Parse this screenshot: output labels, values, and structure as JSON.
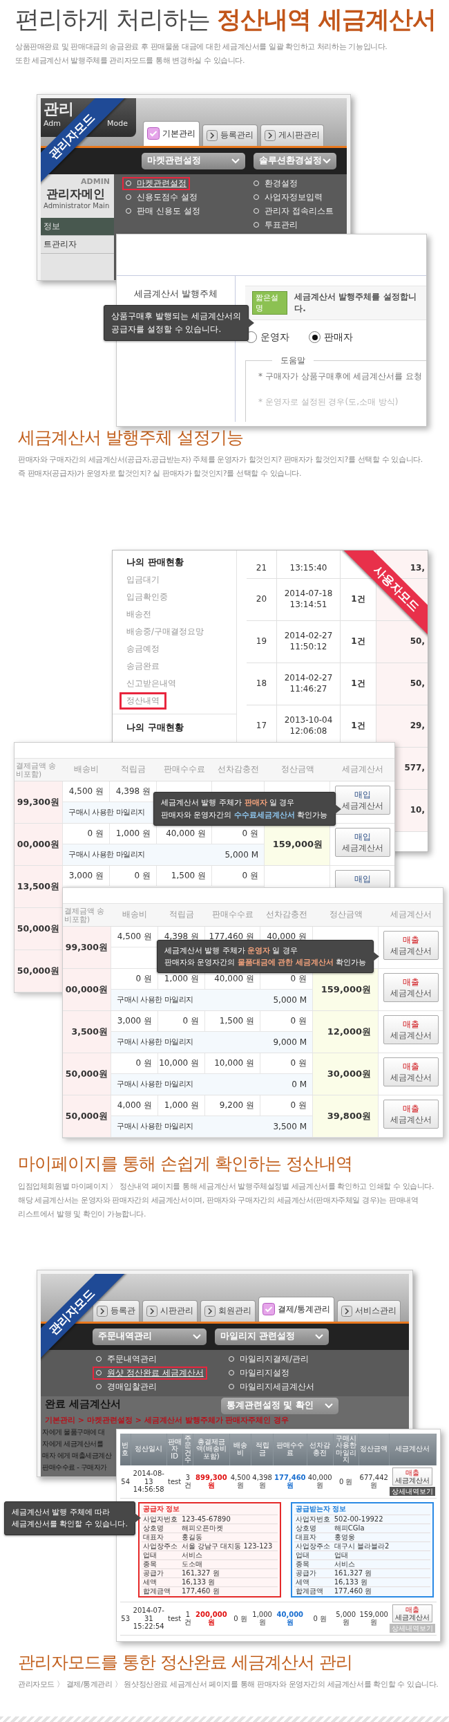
{
  "header": {
    "title": "편리하게 처리하는",
    "title_highlight": "정산내역 세금계산서",
    "description": [
      "상품판매완료 및 판매대금의 송금완료 후 판매물품 대금에 대한 세금계산서를 일괄 확인하고 처리하는 기능입니다.",
      "또한 세금계산서 발행주체를 관리자모드를 통해 변경하실 수 있습니다."
    ]
  },
  "figure_1": {
    "admin_panel": {
      "ribbon": "관리자모드",
      "logo_title": "관리",
      "logo_subtitle": "Adm",
      "logo_mode": "Mode",
      "tabs": [
        {
          "label": "기본관리",
          "selected": true
        },
        {
          "label": "등록관리",
          "selected": false
        },
        {
          "label": "게시판관리",
          "selected": false
        }
      ],
      "menus": [
        {
          "title": "마켓관련설정",
          "items": [
            {
              "label": "마켓관련설정",
              "highlighted": true
            },
            {
              "label": "신용도점수 설정",
              "highlighted": false
            },
            {
              "label": "판매 신용도 설정",
              "highlighted": false
            }
          ]
        },
        {
          "title": "솔루션환경설정",
          "items": [
            {
              "label": "환경설정",
              "highlighted": false
            },
            {
              "label": "사업자정보입력",
              "highlighted": false
            },
            {
              "label": "관리자 접속리스트",
              "highlighted": false
            },
            {
              "label": "투표관리",
              "highlighted": false
            }
          ]
        }
      ],
      "side_badge": "ADMIN",
      "side_title": "관리자메인",
      "side_subtitle": "Administrator Main",
      "side_items": [
        "정보",
        "트관리자"
      ]
    },
    "settings_panel": {
      "label": "세금계산서 발행주체",
      "tag": "짧은설명",
      "description": "세금계산서 발행주체를 설정합니다.",
      "options": [
        {
          "label": "운영자",
          "selected": false
        },
        {
          "label": "판매자",
          "selected": true
        }
      ],
      "help_title": "도움말",
      "help_lines": [
        "* 구매자가 상품구매후에 세금계산서를 요청",
        "* 운영자로 설정된 경우(도,소매 방식)"
      ]
    },
    "callout": {
      "lines": [
        [
          {
            "text": "상품구매후 발행되는 세금계산서의"
          }
        ],
        [
          {
            "text": "공급자를 설정할 수 있습니다."
          }
        ]
      ]
    }
  },
  "section_2": {
    "title": "세금계산서 발행주체 설정기능",
    "description": [
      "판매자와 구매자간의 세금계산서(공급자,공급받는자) 주체를 운영자가 할것인지? 판매자가 할것인지?를 선택할 수 있습니다.",
      "즉 판매자(공급자)가 운영자로 할것인지? 실 판매자가 할것인지?를 선택할 수 있습니다."
    ]
  },
  "figure_2": {
    "mypage_panel": {
      "ribbon": "사용자모드",
      "sales_title": "나의 판매현황",
      "sales_items": [
        {
          "label": "입금대기",
          "highlighted": false
        },
        {
          "label": "입금확인중",
          "highlighted": false
        },
        {
          "label": "배송전",
          "highlighted": false
        },
        {
          "label": "배송중/구매결정요망",
          "highlighted": false
        },
        {
          "label": "송금예정",
          "highlighted": false
        },
        {
          "label": "송금완료",
          "highlighted": false
        },
        {
          "label": "신고받은내역",
          "highlighted": false
        },
        {
          "label": "정산내역",
          "highlighted": true
        }
      ],
      "purchase_title": "나의 구매현황",
      "orders": [
        {
          "no": "21",
          "time": "13:15:40",
          "amount": "13,"
        },
        {
          "no": "20",
          "date": "2014-07-18",
          "time": "13:14:51",
          "count": "1건"
        },
        {
          "no": "19",
          "date": "2014-02-27",
          "time": "11:50:12",
          "count": "1건",
          "amount": "50,"
        },
        {
          "no": "18",
          "date": "2014-02-27",
          "time": "11:46:27",
          "count": "1건",
          "amount": "50,"
        },
        {
          "no": "17",
          "date": "2013-10-04",
          "time": "12:06:08",
          "count": "1건",
          "amount": "29,"
        },
        {
          "amount": "577,"
        },
        {
          "amount": "10,"
        }
      ]
    },
    "purchase_table": {
      "kind": "purchase",
      "columns": [
        "결제금액 송비포함)",
        "배송비",
        "적립금",
        "판매수수료",
        "선차감충전",
        "정산금액",
        "세금계산서"
      ],
      "rows": [
        {
          "paid": "99,300원",
          "shipping": "4,500 원",
          "points": "4,398 원",
          "mileage_label": "구매시 사용한 마일리지",
          "invoice": [
            "매입",
            "세금계산서"
          ]
        },
        {
          "paid": "00,000원",
          "shipping": "0 원",
          "points": "1,000 원",
          "fee": "40,000 원",
          "deduction": "0 원",
          "settlement": "159,000원",
          "mileage_label": "구매시 사용한 마일리지",
          "mileage": "5,000 M",
          "invoice": [
            "매입",
            "세금계산서"
          ]
        },
        {
          "paid": "13,500원",
          "shipping": "3,000 원",
          "points": "0 원",
          "fee": "1,500 원",
          "deduction": "0 원",
          "invoice": [
            "매입"
          ]
        },
        {
          "paid": "50,000원"
        },
        {
          "paid": "50,000원"
        }
      ]
    },
    "purchase_callout": {
      "lines": [
        [
          {
            "text": "세금계산서 발행 주체가 "
          },
          {
            "text": "판매자",
            "color": "#f3a27c"
          },
          {
            "text": " 일 경우"
          }
        ],
        [
          {
            "text": "판매자와 운영자간의 "
          },
          {
            "text": "수수료세금계산서",
            "color": "#8fc6ee"
          },
          {
            "text": " 확인가능"
          }
        ]
      ]
    },
    "sales_table": {
      "kind": "sales",
      "columns": [
        "결제금액 송비포함)",
        "배송비",
        "적립금",
        "판매수수료",
        "선차감충전",
        "정산금액",
        "세금계산서"
      ],
      "rows": [
        {
          "paid": "99,300원",
          "shipping": "4,500 원",
          "points": "4,398 원",
          "fee": "177,460 원",
          "deduction": "40,000 원",
          "invoice": [
            "매출",
            "세금계산서"
          ]
        },
        {
          "paid": "00,000원",
          "shipping": "0 원",
          "points": "1,000 원",
          "fee": "40,000 원",
          "deduction": "0 원",
          "settlement": "159,000원",
          "mileage_label": "구매시 사용한 마일리지",
          "mileage": "5,000 M",
          "invoice": [
            "매출",
            "세금계산서"
          ]
        },
        {
          "paid": "3,500원",
          "shipping": "3,000 원",
          "points": "0 원",
          "fee": "1,500 원",
          "deduction": "0 원",
          "settlement": "12,000원",
          "mileage_label": "구매시 사용한 마일리지",
          "mileage": "9,000 M",
          "invoice": [
            "매출",
            "세금계산서"
          ]
        },
        {
          "paid": "50,000원",
          "shipping": "0 원",
          "points": "10,000 원",
          "fee": "10,000 원",
          "deduction": "0 원",
          "settlement": "30,000원",
          "mileage_label": "구매시 사용한 마일리지",
          "mileage": "0 M",
          "invoice": [
            "매출",
            "세금계산서"
          ]
        },
        {
          "paid": "50,000원",
          "shipping": "4,000 원",
          "points": "1,000 원",
          "fee": "9,200 원",
          "deduction": "0 원",
          "settlement": "39,800원",
          "mileage_label": "구매시 사용한 마일리지",
          "mileage": "3,500 M",
          "invoice": [
            "매출",
            "세금계산서"
          ]
        }
      ]
    },
    "sales_callout": {
      "lines": [
        [
          {
            "text": "세금계산서 발행 주체가 "
          },
          {
            "text": "운영자",
            "color": "#f3a27c"
          },
          {
            "text": " 일 경우"
          }
        ],
        [
          {
            "text": "판매자와 운영자간의 "
          },
          {
            "text": "물품대금에 관한 세금계산서",
            "color": "#f3a27c"
          },
          {
            "text": " 확인가능"
          }
        ]
      ]
    }
  },
  "section_3": {
    "title": "마이페이지를 통해 손쉽게 확인하는 정산내역",
    "description": [
      "입점업체회원별 마이페이지 〉 정산내역 페이지를 통해 세금계산서 발행주체설정별 세금계산서를 확인하고 인쇄할 수 있습니다.",
      "해당 세금계산서는 운영자와 판매자간의 세금계산서이며, 판매자와 구매자간의 세금계산서(판매자주체일 경우)는 판매내역",
      "리스트에서 발행 및 확인이 가능합니다."
    ]
  },
  "figure_3": {
    "admin_panel": {
      "ribbon": "관리자모드",
      "tabs": [
        {
          "label": "등록관",
          "selected": false
        },
        {
          "label": "시판관리",
          "selected": false
        },
        {
          "label": "회원관리",
          "selected": false
        },
        {
          "label": "결제/통계관리",
          "selected": true
        },
        {
          "label": "서비스관리",
          "selected": false
        }
      ],
      "menus": [
        {
          "title": "주문내역관리",
          "items": [
            {
              "label": "주문내역관리",
              "highlighted": false
            },
            {
              "label": "원샷 정산완료 세금계산서",
              "highlighted": true
            },
            {
              "label": "경매입찰관리",
              "highlighted": false
            }
          ]
        },
        {
          "title": "마일리지 관련설정",
          "items": [
            {
              "label": "마일리지결제/관리",
              "highlighted": false
            },
            {
              "label": "마일리지설정",
              "highlighted": false
            },
            {
              "label": "마일리지세금계산서",
              "highlighted": false
            }
          ]
        }
      ],
      "page_title": "완료 세금계산서",
      "dropdown": "통계관련설정 및 확인",
      "breadcrumb": "기본관리 > 마켓관련설정 > 세금계산서 발행주체가 판매자주체인 경우",
      "page_lines": [
        "자에게 물품구매에 대",
        "자에게 세금계산서를",
        "매자 에게 매출세금계산",
        "판매수수료 - 구매자가"
      ]
    },
    "statement_panel": {
      "columns": [
        "번호",
        "정산일시",
        "판매자ID",
        "주문건수",
        "총결제금액(배송비포함)",
        "배송비",
        "적립금",
        "판매수수료",
        "선차감충전",
        "구매시사용한 마일리지",
        "정산금액",
        "세금계산서"
      ],
      "orders": [
        {
          "cells": [
            "54",
            "2014-08-13 14:56:58",
            "test",
            "3 건",
            "899,300 원",
            "4,500 원",
            "4,398 원",
            "177,460 원",
            "40,000 원",
            "0 원",
            "677,442 원"
          ],
          "invoice": [
            "매출",
            "세금계산서"
          ],
          "detail": "상세내역보기",
          "expanded": true
        },
        {
          "cells": [
            "53",
            "2014-07-31 15:22:54",
            "test",
            "1 건",
            "200,000 원",
            "0 원",
            "1,000 원",
            "40,000 원",
            "0 원",
            "5,000 원",
            "159,000 원"
          ],
          "invoice": [
            "매출",
            "세금계산서"
          ],
          "detail": "상세내역보기",
          "expanded": false
        }
      ],
      "supplier": {
        "title": "공급자 정보",
        "rows": [
          {
            "label": "사업자번호",
            "value": "123-45-67890"
          },
          {
            "label": "상호명",
            "value": "해피오픈마켓"
          },
          {
            "label": "대표자",
            "value": "홍길동"
          },
          {
            "label": "사업장주소",
            "value": "서울 강남구 대치동 123-123"
          },
          {
            "label": "업태",
            "value": "서비스"
          },
          {
            "label": "종목",
            "value": "도소매"
          },
          {
            "label": "공급가",
            "value": "161,327 원"
          },
          {
            "label": "세액",
            "value": "16,133 원"
          },
          {
            "label": "합계금액",
            "value": "177,460 원"
          }
        ]
      },
      "buyer": {
        "title": "공급받는자 정보",
        "rows": [
          {
            "label": "사업자번호",
            "value": "502-00-19922"
          },
          {
            "label": "상호명",
            "value": "해피CGIa"
          },
          {
            "label": "대표자",
            "value": "홍영웅"
          },
          {
            "label": "사업장주소",
            "value": "대구시 블라블라2"
          },
          {
            "label": "업태",
            "value": "업태"
          },
          {
            "label": "종목",
            "value": "서비스"
          },
          {
            "label": "공급가",
            "value": "161,327 원"
          },
          {
            "label": "세액",
            "value": "16,133 원"
          },
          {
            "label": "합계금액",
            "value": "177,460 원"
          }
        ]
      }
    },
    "callout": {
      "lines": [
        [
          {
            "text": "세금계산서 발행 주체에 따라"
          }
        ],
        [
          {
            "text": "세금계산서를 확인할 수 있습니다."
          }
        ]
      ]
    }
  },
  "section_4": {
    "title": "관리자모드를 통한 정산완료 세금계산서 관리",
    "description": [
      "관리자모드 〉 결제/통계관리 〉 원샷정산완료 세금계산서 페이지를 통해 판매자와 운영자간의 세금계산서를 확인할 수 있습니다."
    ]
  }
}
